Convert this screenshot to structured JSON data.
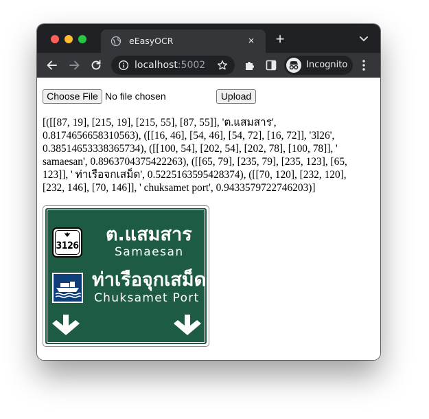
{
  "browser": {
    "tab_title": "eEasyOCR",
    "tab_close": "×",
    "new_tab": "+",
    "url_host": "localhost",
    "url_port": ":5002",
    "profile_label": "Incognito",
    "chrome_color": "#202124",
    "toolbar_color": "#35363a"
  },
  "icons": {
    "tab_favicon": "globe-icon",
    "back": "back-arrow-icon",
    "forward": "forward-arrow-icon",
    "reload": "reload-icon",
    "site_info": "info-icon",
    "bookmark": "star-icon",
    "extensions": "puzzle-icon",
    "side_panel": "side-panel-icon",
    "incognito": "incognito-icon",
    "menu": "kebab-menu-icon",
    "tab_search": "chevron-down-icon"
  },
  "form": {
    "choose_file_label": "Choose File",
    "file_status": "No file chosen",
    "upload_label": "Upload"
  },
  "result_text": "[([[87, 19], [215, 19], [215, 55], [87, 55]], 'ต.แสมสาร', 0.8174656658310563), ([[16, 46], [54, 46], [54, 72], [16, 72]], '3l26', 0.38514653338365734), ([[100, 54], [202, 54], [202, 78], [100, 78]], ' samaesan', 0.8963704375422263), ([[65, 79], [235, 79], [235, 123], [65, 123]], ' ท่าเรือจกเสม็ด', 0.5225163595428374), ([[70, 120], [232, 120], [232, 146], [70, 146]], ' chuksamet port', 0.9433579722746203)]",
  "sign": {
    "route_number": "3126",
    "line1_thai": "ต.แสมสาร",
    "line1_en": "Samaesan",
    "line2_thai": "ท่าเรือจุกเสม็ด",
    "line2_en": "Chuksamet Port",
    "background_color": "#1d5c42",
    "ferry_panel_color": "#0e3f7a"
  }
}
